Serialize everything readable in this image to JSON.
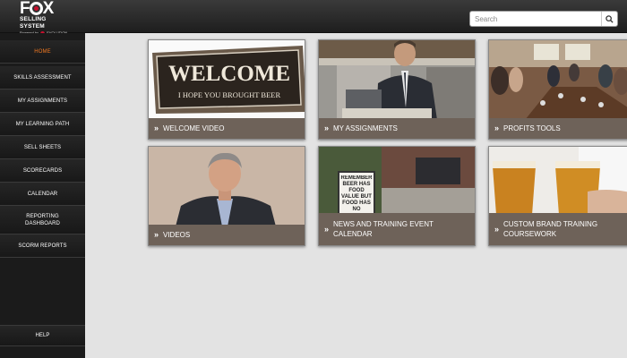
{
  "header": {
    "logo": {
      "main": "FOX",
      "sub": "SELLING SYSTEM",
      "powered": "Powered by",
      "powered_brand": "EVOLUTION"
    },
    "search": {
      "placeholder": "Search",
      "value": ""
    },
    "search_icon": "magnifier-icon"
  },
  "sidebar": {
    "items": [
      {
        "label": "HOME",
        "active": true
      },
      {
        "label": "SKILLS ASSESSMENT"
      },
      {
        "label": "MY ASSIGNMENTS"
      },
      {
        "label": "MY LEARNING PATH"
      },
      {
        "label": "SELL SHEETS"
      },
      {
        "label": "SCORECARDS"
      },
      {
        "label": "CALENDAR"
      },
      {
        "label": "REPORTING DASHBOARD"
      },
      {
        "label": "SCORM REPORTS"
      }
    ],
    "help": "HELP",
    "active_color": "#f47920"
  },
  "tiles": [
    {
      "title": "WELCOME VIDEO",
      "image": "welcome-sign-photo",
      "sign_main": "WELCOME",
      "sign_sub": "I HOPE YOU BROUGHT BEER"
    },
    {
      "title": "MY ASSIGNMENTS",
      "image": "businessman-laptop-photo"
    },
    {
      "title": "PROFITS TOOLS",
      "image": "restaurant-meeting-photo"
    },
    {
      "title": "VIDEOS",
      "image": "presenter-video-photo"
    },
    {
      "title": "NEWS AND TRAINING EVENT CALENDAR",
      "image": "beer-sidewalk-sign-photo",
      "sign_text": "REMEMBER BEER HAS FOOD VALUE BUT FOOD HAS NO"
    },
    {
      "title": "CUSTOM BRAND TRAINING COURSEWORK",
      "image": "beer-glasses-photo"
    }
  ],
  "colors": {
    "caption_bg": "#6e6259",
    "header_bg": "#2a2a2a",
    "sidebar_bg": "#1b1b1b"
  }
}
